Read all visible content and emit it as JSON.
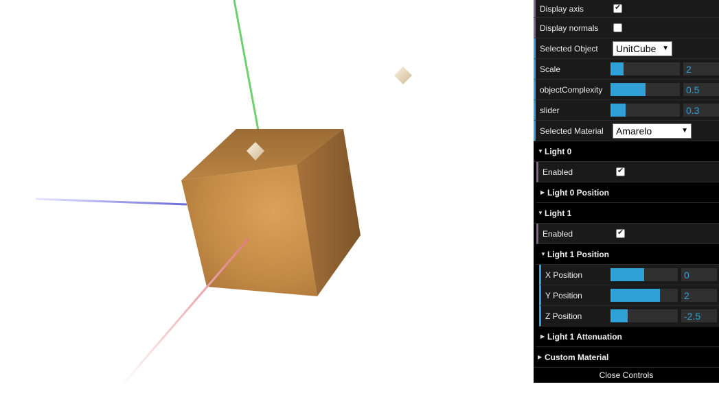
{
  "controls": {
    "display_axis": {
      "label": "Display axis",
      "checked": true
    },
    "display_normals": {
      "label": "Display normals",
      "checked": false
    },
    "selected_object": {
      "label": "Selected Object",
      "value": "UnitCube"
    },
    "scale": {
      "label": "Scale",
      "value": "2",
      "fraction": 0.19
    },
    "object_complexity": {
      "label": "objectComplexity",
      "value": "0.5",
      "fraction": 0.5
    },
    "slider": {
      "label": "slider",
      "value": "0.3",
      "fraction": 0.22
    },
    "selected_material": {
      "label": "Selected Material",
      "value": "Amarelo"
    }
  },
  "light0": {
    "title": "Light 0",
    "enabled_label": "Enabled",
    "enabled": true,
    "position_title": "Light 0 Position"
  },
  "light1": {
    "title": "Light 1",
    "enabled_label": "Enabled",
    "enabled": true,
    "position_title": "Light 1 Position",
    "x": {
      "label": "X Position",
      "value": "0",
      "fraction": 0.5
    },
    "y": {
      "label": "Y Position",
      "value": "2",
      "fraction": 0.73
    },
    "z": {
      "label": "Z Position",
      "value": "-2.5",
      "fraction": 0.25
    },
    "attenuation_title": "Light 1 Attenuation"
  },
  "custom_material": {
    "title": "Custom Material"
  },
  "close_label": "Close Controls",
  "colors": {
    "cube": "#d39a52",
    "axis_x": "#e07a80",
    "axis_y": "#6fd06f",
    "axis_z": "#6a6ad8",
    "slider_fill": "#2fa1d6"
  }
}
